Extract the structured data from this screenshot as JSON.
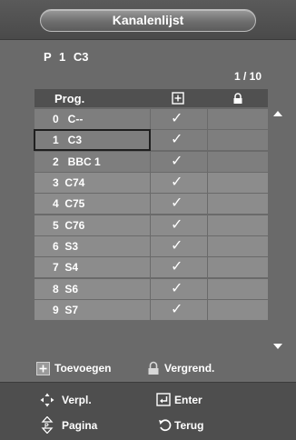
{
  "title": "Kanalenlijst",
  "current_program": "P  1  C3",
  "page_counter": "1 / 10",
  "table": {
    "header_prog": "Prog.",
    "header_add_icon": "add-box-icon",
    "header_lock_icon": "lock-icon",
    "rows": [
      {
        "label": "0   C--",
        "added": true,
        "locked": false
      },
      {
        "label": "1   C3",
        "added": true,
        "locked": false
      },
      {
        "label": "2   BBC 1",
        "added": true,
        "locked": false
      },
      {
        "label": "3  C74",
        "added": true,
        "locked": false
      },
      {
        "label": "4  C75",
        "added": true,
        "locked": false
      },
      {
        "label": "5  C76",
        "added": true,
        "locked": false
      },
      {
        "label": "6  S3",
        "added": true,
        "locked": false
      },
      {
        "label": "7  S4",
        "added": true,
        "locked": false
      },
      {
        "label": "8  S6",
        "added": true,
        "locked": false
      },
      {
        "label": "9  S7",
        "added": true,
        "locked": false
      }
    ],
    "check_glyph": "✓"
  },
  "legend": {
    "add_label": "Toevoegen",
    "lock_label": "Vergrend."
  },
  "bottom": {
    "move_label": "Verpl.",
    "enter_label": "Enter",
    "page_label": "Pagina",
    "return_label": "Terug"
  },
  "colors": {
    "background": "#6b6b6b",
    "cell": "#8c8c8c",
    "header": "#505050",
    "bar": "#4e4e4e",
    "text": "#ffffff"
  }
}
